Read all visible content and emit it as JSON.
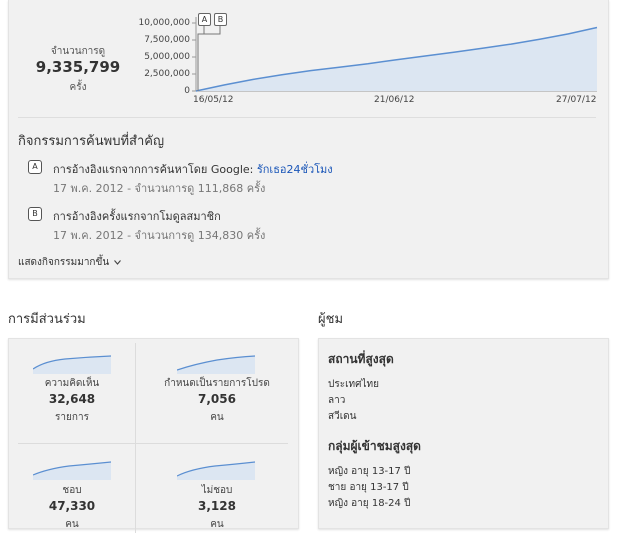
{
  "views_summary": {
    "label": "จำนวนการดู",
    "value": "9,335,799",
    "unit": "ครั้ง"
  },
  "chart_data": {
    "type": "area",
    "title": "",
    "xlabel": "",
    "ylabel": "",
    "y_tick_labels": [
      "10,000,000",
      "7,500,000",
      "5,000,000",
      "2,500,000",
      "0"
    ],
    "x_tick_labels": [
      "16/05/12",
      "21/06/12",
      "27/07/12"
    ],
    "ylim": [
      0,
      10000000
    ],
    "grid": false,
    "series": [
      {
        "x": [
          "16/05/12",
          "21/05/12",
          "26/05/12",
          "31/05/12",
          "05/06/12",
          "10/06/12",
          "15/06/12",
          "21/06/12",
          "26/06/12",
          "01/07/12",
          "06/07/12",
          "11/07/12",
          "16/07/12",
          "21/07/12",
          "27/07/12"
        ],
        "values": [
          0,
          900000,
          1700000,
          2400000,
          3000000,
          3500000,
          4000000,
          4600000,
          5150000,
          5700000,
          6300000,
          6900000,
          7600000,
          8400000,
          9335799
        ]
      }
    ],
    "markers": [
      "A",
      "B"
    ],
    "colors": {
      "line": "#5b8fd1",
      "fill": "#dce6f2"
    }
  },
  "activity": {
    "heading": "กิจกรรมการค้นพบที่สำคัญ",
    "items": [
      {
        "badge": "A",
        "text": "การอ้างอิงแรกจากการค้นหาโดย Google: ",
        "link": "รักเธอ24ชั่วโมง",
        "meta": "17 พ.ค. 2012 - จำนวนการดู 111,868 ครั้ง"
      },
      {
        "badge": "B",
        "text": "การอ้างอิงครั้งแรกจากโมดูลสมาชิก",
        "link": "",
        "meta": "17 พ.ค. 2012 - จำนวนการดู 134,830 ครั้ง"
      }
    ],
    "more": "แสดงกิจกรรมมากขึ้น",
    "more_icon": "chevron-down-icon"
  },
  "engagement": {
    "title": "การมีส่วนร่วม",
    "metrics": [
      {
        "label": "ความคิดเห็น",
        "value": "32,648",
        "unit": "รายการ"
      },
      {
        "label": "กำหนดเป็นรายการโปรด",
        "value": "7,056",
        "unit": "คน"
      },
      {
        "label": "ชอบ",
        "value": "47,330",
        "unit": "คน"
      },
      {
        "label": "ไม่ชอบ",
        "value": "3,128",
        "unit": "คน"
      }
    ]
  },
  "audience": {
    "title": "ผู้ชม",
    "top_locations_heading": "สถานที่สูงสุด",
    "top_locations": [
      "ประเทศไทย",
      "ลาว",
      "สวีเดน"
    ],
    "top_demographics_heading": "กลุ่มผู้เข้าชมสูงสุด",
    "top_demographics": [
      "หญิง อายุ 13-17 ปี",
      "ชาย อายุ 13-17 ปี",
      "หญิง อายุ 18-24 ปี"
    ]
  }
}
